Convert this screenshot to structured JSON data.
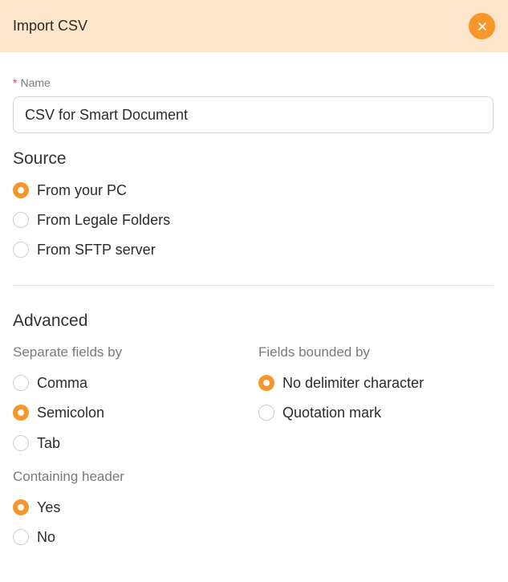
{
  "dialog": {
    "title": "Import CSV",
    "close_icon": "close-icon",
    "accent_color": "#f7962a",
    "header_color": "#fde5cc"
  },
  "name": {
    "required_mark": "*",
    "label": "Name",
    "value": "CSV for Smart Document"
  },
  "source": {
    "title": "Source",
    "selected": "From your PC",
    "options": [
      "From your PC",
      "From Legale Folders",
      "From SFTP server"
    ]
  },
  "advanced": {
    "title": "Advanced",
    "separate": {
      "label": "Separate fields by",
      "selected": "Semicolon",
      "options": [
        "Comma",
        "Semicolon",
        "Tab"
      ]
    },
    "bounded": {
      "label": "Fields bounded by",
      "selected": "No delimiter character",
      "options": [
        "No delimiter character",
        "Quotation mark"
      ]
    },
    "header": {
      "label": "Containing header",
      "selected": "Yes",
      "options": [
        "Yes",
        "No"
      ]
    }
  }
}
